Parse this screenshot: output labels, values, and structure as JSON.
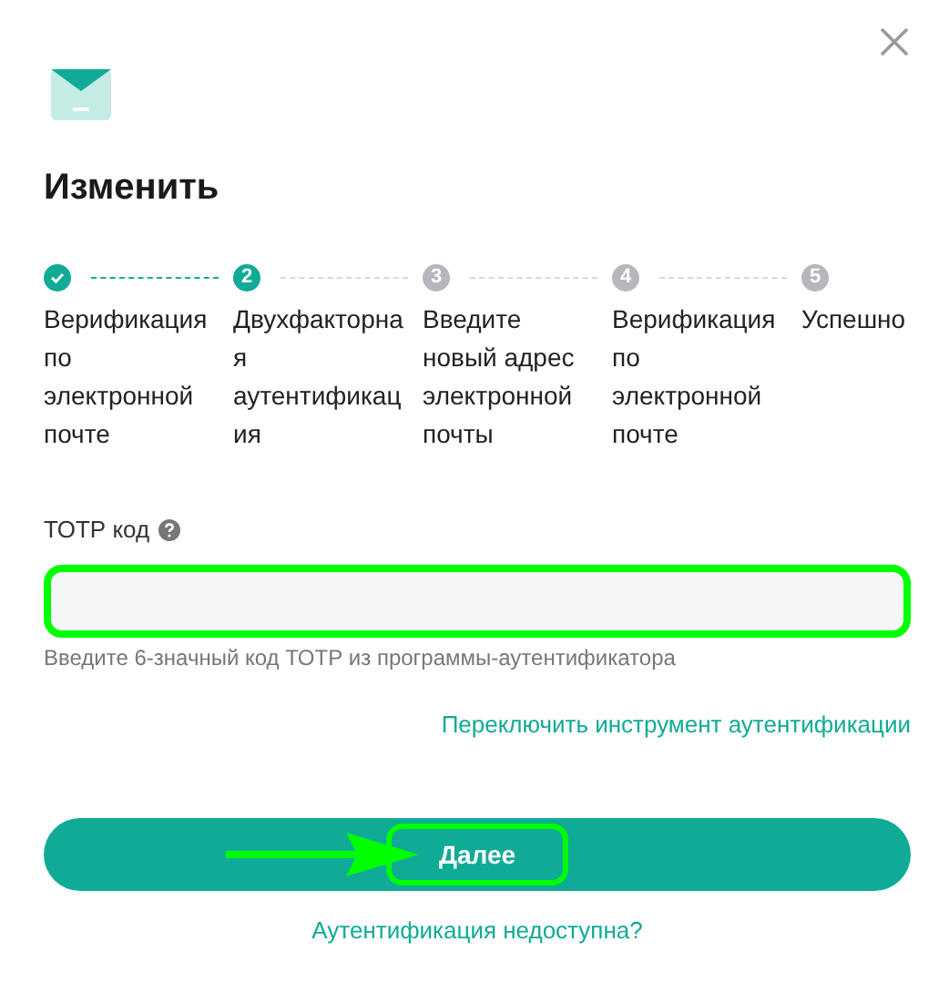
{
  "title": "Изменить",
  "steps": [
    {
      "kind": "done",
      "label": "Верификация по электронной почте"
    },
    {
      "kind": "current",
      "number": "2",
      "label": "Двухфакторная аутентификация"
    },
    {
      "kind": "pending",
      "number": "3",
      "label": "Введите новый адрес электронной почты"
    },
    {
      "kind": "pending",
      "number": "4",
      "label": "Верификация по электронной почте"
    },
    {
      "kind": "pending",
      "number": "5",
      "label": "Успешно"
    }
  ],
  "field": {
    "label": "ТОТР код",
    "hint": "Введите 6-значный код ТОТР из программы-аутентификатора",
    "highlighted": true
  },
  "switch_link": "Переключить инструмент аутентификации",
  "next_button": {
    "label": "Далее",
    "highlighted": true,
    "arrow": true
  },
  "unavailable_link": "Аутентификация недоступна?"
}
